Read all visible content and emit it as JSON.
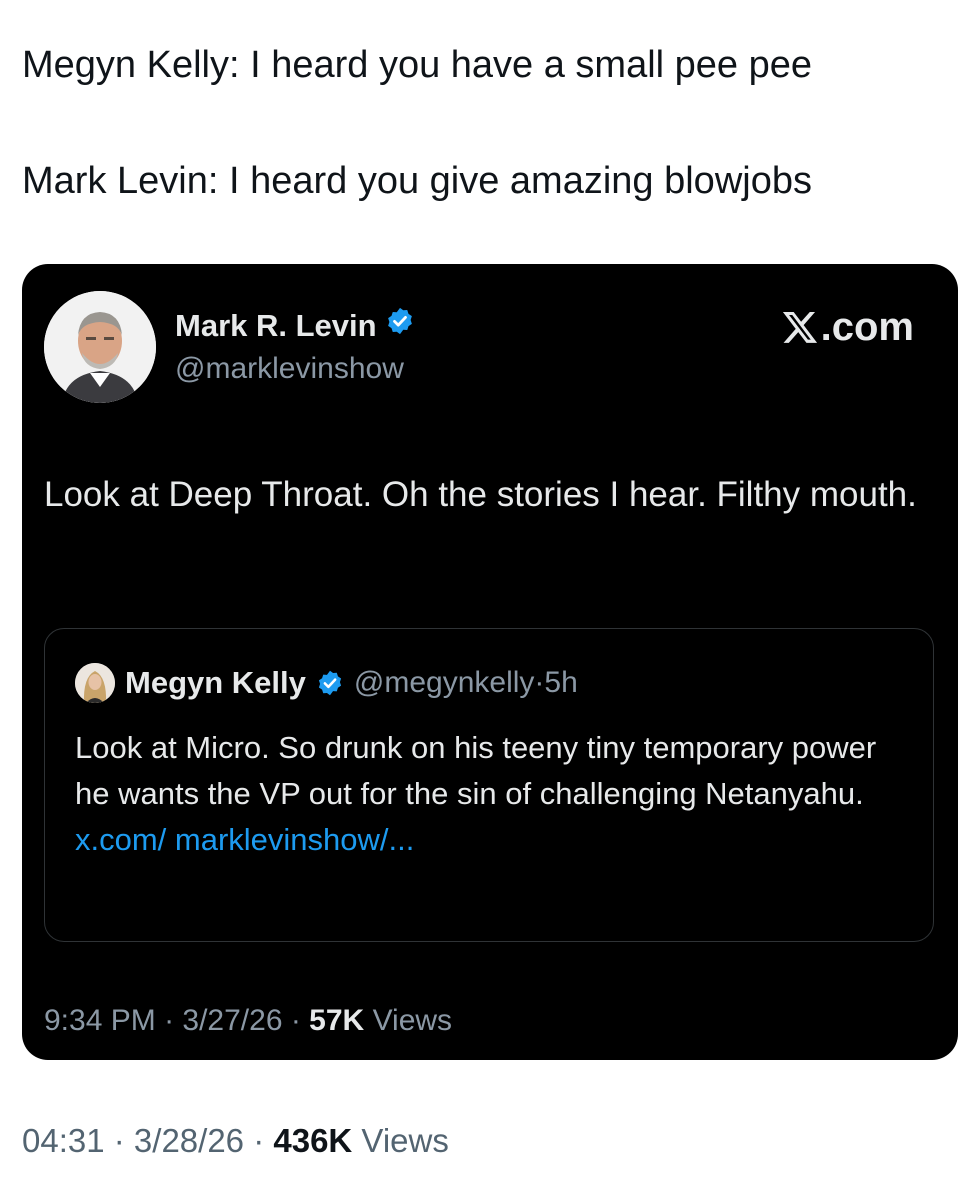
{
  "post": {
    "line1": "Megyn Kelly: I heard you have a small pee pee",
    "line2": "Mark Levin: I heard you give amazing blowjobs",
    "time": "04:31",
    "date": "3/28/26",
    "views_count": "436K",
    "views_label": "Views",
    "separator": " · "
  },
  "embedded_tweet": {
    "author_name": "Mark R. Levin",
    "author_handle": "@marklevinshow",
    "verified": true,
    "source_label": ".com",
    "source_icon": "x-logo-icon",
    "text": "Look at Deep Throat. Oh the stories I hear. Filthy mouth.",
    "time": "9:34 PM",
    "date": "3/27/26",
    "views_count": "57K",
    "views_label": "Views",
    "quote": {
      "author_name": "Megyn Kelly",
      "author_handle": "@megynkelly",
      "age": "5h",
      "verified": true,
      "text": "Look at Micro. So drunk on his teeny tiny temporary power he wants the VP out for the sin of challenging Netanyahu.",
      "link_text": "x.com/ marklevinshow/..."
    }
  },
  "colors": {
    "card_bg": "#000000",
    "verified_blue": "#1d9bf0",
    "link_blue": "#1d9bf0",
    "muted_gray": "#8b98a5"
  }
}
